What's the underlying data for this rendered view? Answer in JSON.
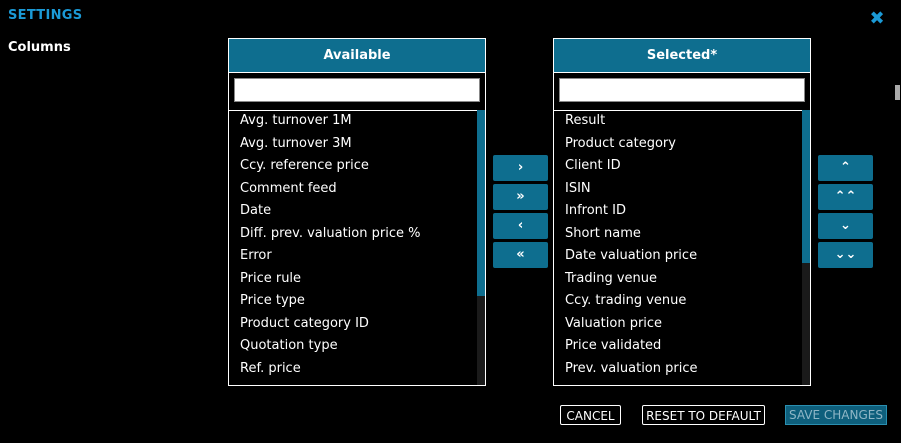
{
  "header": {
    "title": "SETTINGS"
  },
  "columns_label": "Columns",
  "available": {
    "title": "Available",
    "filter_value": "",
    "items": [
      "Avg. turnover 1M",
      "Avg. turnover 3M",
      "Ccy. reference price",
      "Comment feed",
      "Date",
      "Diff. prev. valuation price %",
      "Error",
      "Price rule",
      "Price type",
      "Product category ID",
      "Quotation type",
      "Ref. price"
    ]
  },
  "selected": {
    "title": "Selected*",
    "filter_value": "",
    "items": [
      "Result",
      "Product category",
      "Client ID",
      "ISIN",
      "Infront ID",
      "Short name",
      "Date valuation price",
      "Trading venue",
      "Ccy. trading venue",
      "Valuation price",
      "Price validated",
      "Prev. valuation price"
    ]
  },
  "transfer_buttons": {
    "add": "›",
    "add_all": "»",
    "remove": "‹",
    "remove_all": "«"
  },
  "order_buttons": {
    "up": "⌃",
    "top": "⌃⌃",
    "down": "⌄",
    "bottom": "⌄⌄"
  },
  "footer": {
    "cancel": "CANCEL",
    "reset": "RESET TO DEFAULT",
    "save": "SAVE CHANGES"
  },
  "colors": {
    "accent": "#1b9ad6",
    "header_bg": "#0e6e8f"
  }
}
